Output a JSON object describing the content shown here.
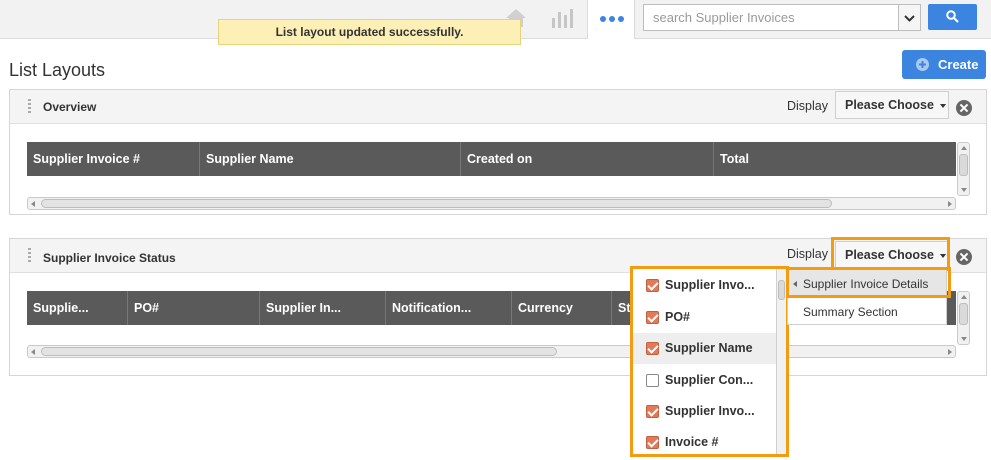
{
  "search": {
    "placeholder": "search Supplier Invoices"
  },
  "toast": {
    "message": "List layout updated successfully."
  },
  "page": {
    "title": "List Layouts",
    "create_label": "Create"
  },
  "panels": [
    {
      "title": "Overview",
      "display_label": "Display",
      "choose_label": "Please Choose",
      "columns": [
        "Supplier Invoice #",
        "Supplier Name",
        "Created on",
        "Total"
      ]
    },
    {
      "title": "Supplier Invoice Status",
      "display_label": "Display",
      "choose_label": "Please Choose",
      "columns": [
        "Supplie...",
        "PO#",
        "Supplier In...",
        "Notification...",
        "Currency",
        "St"
      ]
    }
  ],
  "column_menu": {
    "items": [
      {
        "label": "Supplier Invo...",
        "checked": true
      },
      {
        "label": "PO#",
        "checked": true
      },
      {
        "label": "Supplier Name",
        "checked": true
      },
      {
        "label": "Supplier Con...",
        "checked": false
      },
      {
        "label": "Supplier Invo...",
        "checked": true
      },
      {
        "label": "Invoice #",
        "checked": true
      }
    ]
  },
  "display_menu": {
    "items": [
      "Supplier Invoice Details",
      "Summary Section"
    ]
  },
  "colors": {
    "accent": "#3b84e0",
    "highlight": "#f39c12",
    "checkbox": "#e07b5a",
    "grid_header": "#5a5a5a",
    "toast_bg": "#fcf0b6"
  }
}
